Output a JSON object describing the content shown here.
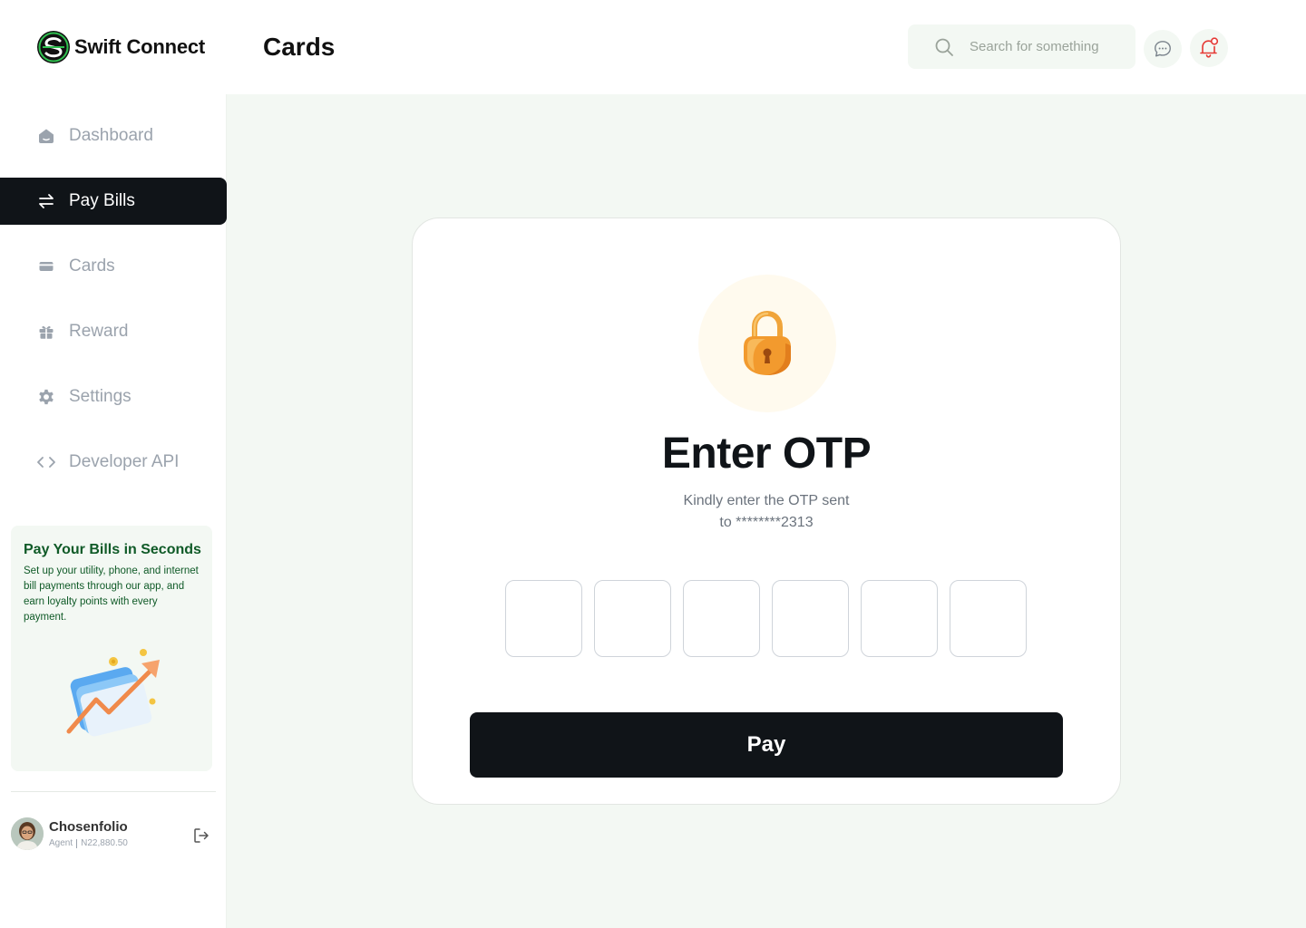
{
  "brand": {
    "name": "Swift Connect",
    "logo_icon": "swift-connect-logo",
    "accent_color": "#1a8a3a"
  },
  "header": {
    "title": "Cards",
    "search": {
      "placeholder": "Search for something",
      "value": "",
      "icon": "search-icon"
    },
    "chat_icon": "chat-bubble-icon",
    "notification_icon": "bell-icon",
    "notification_color": "#e53935"
  },
  "sidebar": {
    "items": [
      {
        "label": "Dashboard",
        "icon": "home-icon",
        "active": false
      },
      {
        "label": "Pay Bills",
        "icon": "transfer-arrows-icon",
        "active": true
      },
      {
        "label": "Cards",
        "icon": "card-icon",
        "active": false
      },
      {
        "label": "Reward",
        "icon": "gift-icon",
        "active": false
      },
      {
        "label": "Settings",
        "icon": "gear-icon",
        "active": false
      },
      {
        "label": "Developer API",
        "icon": "code-icon",
        "active": false
      }
    ],
    "promo": {
      "title": "Pay Your Bills in Seconds",
      "text": "Set up your utility, phone, and internet bill payments through our app, and earn loyalty points with every payment."
    },
    "user": {
      "name": "Chosenfolio",
      "role": "Agent",
      "balance": "N22,880.50"
    }
  },
  "otp": {
    "title": "Enter OTP",
    "subtitle_line1": "Kindly enter the OTP sent",
    "subtitle_line2": "to ********2313",
    "digits": [
      "",
      "",
      "",
      "",
      "",
      ""
    ],
    "submit_label": "Pay",
    "icon": "padlock-icon"
  }
}
